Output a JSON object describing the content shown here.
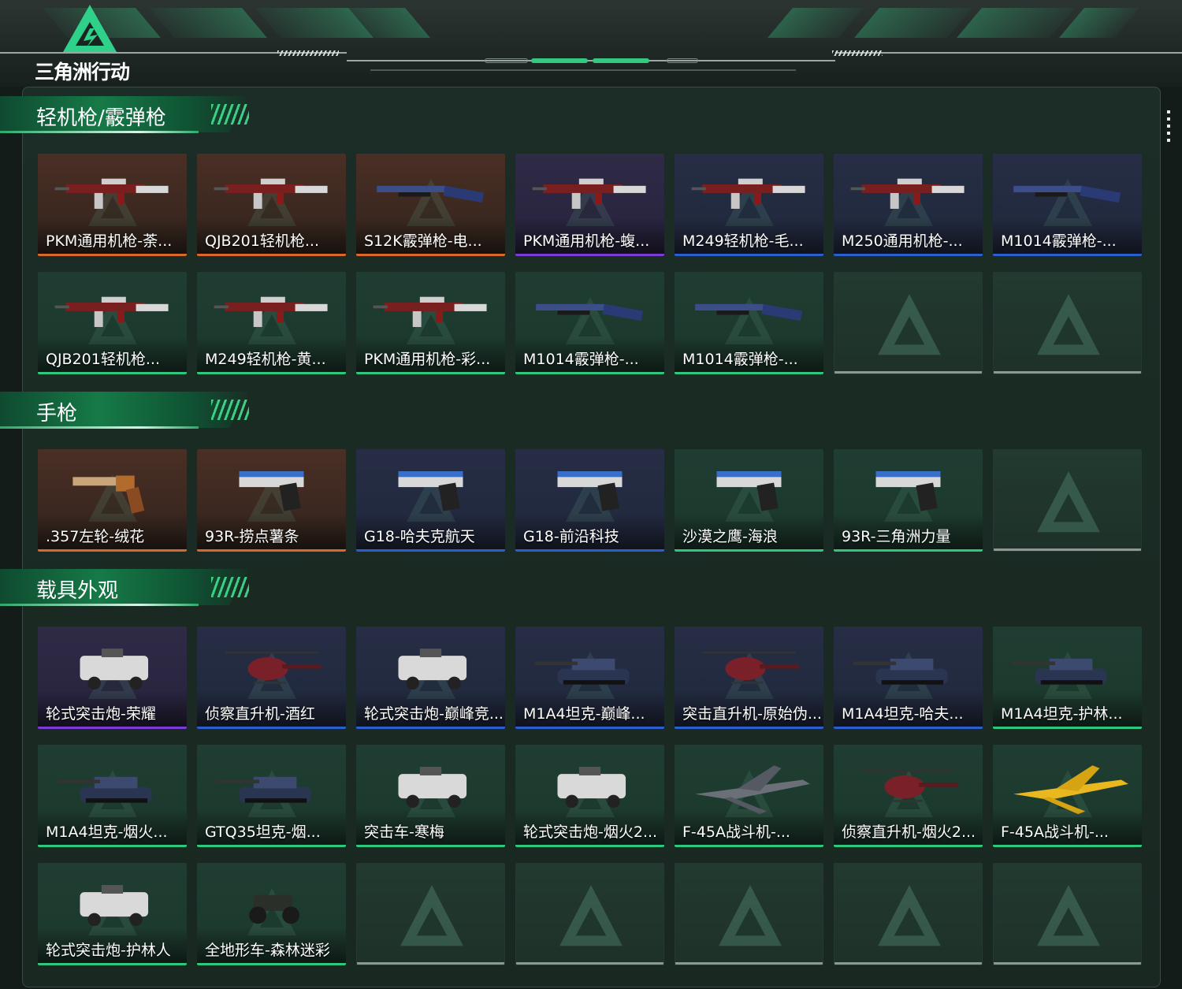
{
  "app": {
    "logo_text": "三角洲行动"
  },
  "colors": {
    "orange": "#d9692a",
    "purple": "#7a3bd6",
    "blue": "#2b5fcf",
    "green": "#2fc77d",
    "gray": "#8f9794"
  },
  "sections": [
    {
      "title": "轻机枪/霰弹枪",
      "items": [
        {
          "name": "PKM通用机枪-荼...",
          "rarity": "orange",
          "bg": "brown",
          "icon": "machine-gun"
        },
        {
          "name": "QJB201轻机枪...",
          "rarity": "orange",
          "bg": "brown",
          "icon": "machine-gun"
        },
        {
          "name": "S12K霰弹枪-电...",
          "rarity": "orange",
          "bg": "brown",
          "icon": "shotgun"
        },
        {
          "name": "PKM通用机枪-蝮...",
          "rarity": "purple",
          "bg": "purple",
          "icon": "machine-gun"
        },
        {
          "name": "M249轻机枪-毛...",
          "rarity": "blue",
          "bg": "navy",
          "icon": "machine-gun"
        },
        {
          "name": "M250通用机枪-...",
          "rarity": "blue",
          "bg": "navy",
          "icon": "machine-gun"
        },
        {
          "name": "M1014霰弹枪-...",
          "rarity": "blue",
          "bg": "navy",
          "icon": "shotgun"
        },
        {
          "name": "QJB201轻机枪...",
          "rarity": "green",
          "bg": "green",
          "icon": "machine-gun"
        },
        {
          "name": "M249轻机枪-黄...",
          "rarity": "green",
          "bg": "green",
          "icon": "machine-gun"
        },
        {
          "name": "PKM通用机枪-彩...",
          "rarity": "green",
          "bg": "green",
          "icon": "machine-gun"
        },
        {
          "name": "M1014霰弹枪-...",
          "rarity": "green",
          "bg": "green",
          "icon": "shotgun"
        },
        {
          "name": "M1014霰弹枪-...",
          "rarity": "green",
          "bg": "green",
          "icon": "shotgun"
        },
        {
          "name": "",
          "rarity": "empty",
          "bg": "empty",
          "icon": ""
        },
        {
          "name": "",
          "rarity": "empty",
          "bg": "empty",
          "icon": ""
        }
      ]
    },
    {
      "title": "手枪",
      "items": [
        {
          "name": ".357左轮-绒花",
          "rarity": "orange",
          "bg": "brown",
          "icon": "revolver"
        },
        {
          "name": "93R-捞点薯条",
          "rarity": "orange",
          "bg": "brown",
          "icon": "pistol"
        },
        {
          "name": "G18-哈夫克航天",
          "rarity": "blue",
          "bg": "navy",
          "icon": "pistol"
        },
        {
          "name": "G18-前沿科技",
          "rarity": "blue",
          "bg": "navy",
          "icon": "pistol"
        },
        {
          "name": "沙漠之鹰-海浪",
          "rarity": "green",
          "bg": "green",
          "icon": "pistol"
        },
        {
          "name": "93R-三角洲力量",
          "rarity": "green",
          "bg": "green",
          "icon": "pistol"
        },
        {
          "name": "",
          "rarity": "empty",
          "bg": "empty",
          "icon": ""
        }
      ]
    },
    {
      "title": "载具外观",
      "items": [
        {
          "name": "轮式突击炮-荣耀",
          "rarity": "purple",
          "bg": "purple",
          "icon": "armored-car"
        },
        {
          "name": "侦察直升机-酒红",
          "rarity": "blue",
          "bg": "navy",
          "icon": "helicopter"
        },
        {
          "name": "轮式突击炮-巅峰竞...",
          "rarity": "blue",
          "bg": "navy",
          "icon": "armored-car"
        },
        {
          "name": "M1A4坦克-巅峰...",
          "rarity": "blue",
          "bg": "navy",
          "icon": "tank"
        },
        {
          "name": "突击直升机-原始伪...",
          "rarity": "blue",
          "bg": "navy",
          "icon": "helicopter"
        },
        {
          "name": "M1A4坦克-哈夫...",
          "rarity": "blue",
          "bg": "navy",
          "icon": "tank"
        },
        {
          "name": "M1A4坦克-护林...",
          "rarity": "green",
          "bg": "green",
          "icon": "tank"
        },
        {
          "name": "M1A4坦克-烟火...",
          "rarity": "green",
          "bg": "green",
          "icon": "tank"
        },
        {
          "name": "GTQ35坦克-烟...",
          "rarity": "green",
          "bg": "green",
          "icon": "tank"
        },
        {
          "name": "突击车-寒梅",
          "rarity": "green",
          "bg": "green",
          "icon": "armored-car"
        },
        {
          "name": "轮式突击炮-烟火2...",
          "rarity": "green",
          "bg": "green",
          "icon": "armored-car"
        },
        {
          "name": "F-45A战斗机-...",
          "rarity": "green",
          "bg": "green",
          "icon": "jet"
        },
        {
          "name": "侦察直升机-烟火2...",
          "rarity": "green",
          "bg": "green",
          "icon": "helicopter"
        },
        {
          "name": "F-45A战斗机-...",
          "rarity": "green",
          "bg": "green",
          "icon": "jet"
        },
        {
          "name": "轮式突击炮-护林人",
          "rarity": "green",
          "bg": "green",
          "icon": "armored-car"
        },
        {
          "name": "全地形车-森林迷彩",
          "rarity": "green",
          "bg": "green",
          "icon": "atv"
        },
        {
          "name": "",
          "rarity": "empty",
          "bg": "empty",
          "icon": ""
        },
        {
          "name": "",
          "rarity": "empty",
          "bg": "empty",
          "icon": ""
        },
        {
          "name": "",
          "rarity": "empty",
          "bg": "empty",
          "icon": ""
        },
        {
          "name": "",
          "rarity": "empty",
          "bg": "empty",
          "icon": ""
        },
        {
          "name": "",
          "rarity": "empty",
          "bg": "empty",
          "icon": ""
        }
      ]
    }
  ]
}
